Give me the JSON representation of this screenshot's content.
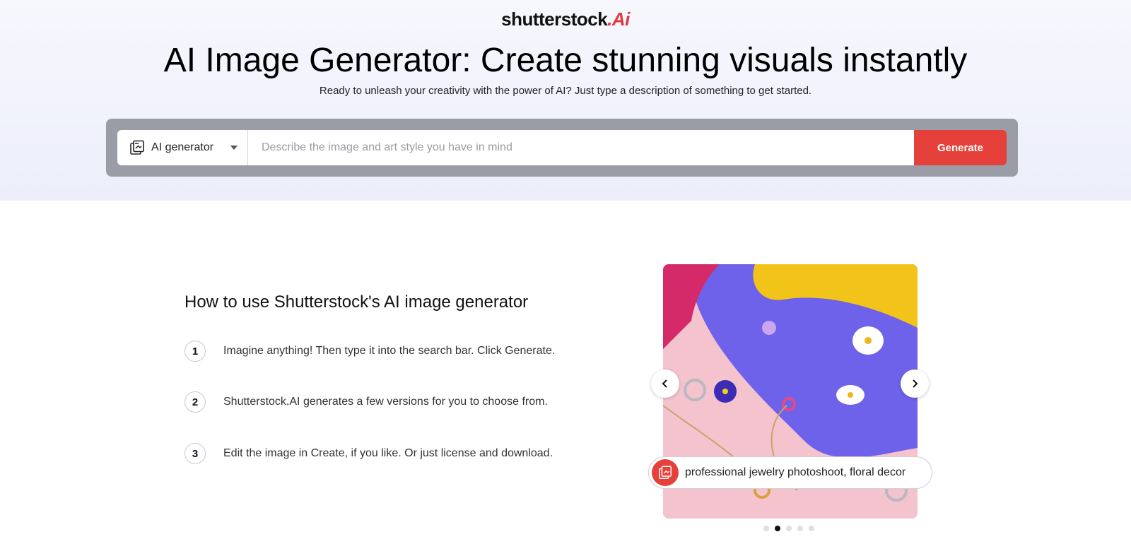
{
  "brand": {
    "name": "shutterstock",
    "suffix": ".Ai"
  },
  "hero": {
    "title": "AI Image Generator: Create stunning visuals instantly",
    "subtitle": "Ready to unleash your creativity with the power of AI? Just type a description of something to get started."
  },
  "search": {
    "mode_label": "AI generator",
    "placeholder": "Describe the image and art style you have in mind",
    "value": "",
    "generate_label": "Generate"
  },
  "howto": {
    "title": "How to use Shutterstock's AI image generator",
    "steps": [
      {
        "num": "1",
        "text": "Imagine anything! Then type it into the search bar. Click Generate."
      },
      {
        "num": "2",
        "text": "Shutterstock.AI generates a few versions for you to choose from."
      },
      {
        "num": "3",
        "text": "Edit the image in Create, if you like. Or just license and download."
      }
    ]
  },
  "showcase": {
    "prompt": "professional jewelry photoshoot, floral decor",
    "slide_count": 5,
    "active_slide": 2
  },
  "icons": {
    "mode": "ai-generator-icon",
    "prev": "chevron-left-icon",
    "next": "chevron-right-icon",
    "chip": "ai-generator-icon",
    "caret": "caret-down-icon"
  },
  "colors": {
    "accent": "#e5413a",
    "hero_bg": "#eceefb",
    "search_frame": "#9a9ca6",
    "showcase_purple": "#6e62ea",
    "showcase_yellow": "#f2c318",
    "showcase_pink": "#f4c3cd"
  }
}
